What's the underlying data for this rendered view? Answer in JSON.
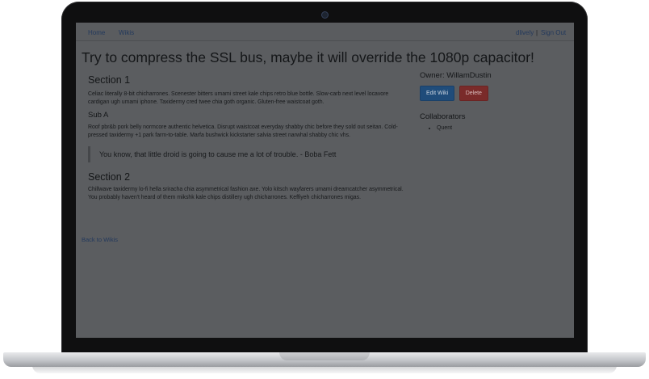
{
  "nav": {
    "home": "Home",
    "wikis": "Wikis",
    "user": "dlively",
    "separator": "|",
    "signout": "Sign Out"
  },
  "wiki": {
    "title": "Try to compress the SSL bus, maybe it will override the 1080p capacitor!",
    "sections": [
      {
        "heading": "Section 1",
        "body": "Celiac literally 8-bit chicharrones. Scenester bitters umami street kale chips retro blue bottle. Slow-carb next level locavore cardigan ugh umami iphone. Taxidermy cred twee chia goth organic. Gluten-free waistcoat goth.",
        "sub_heading": "Sub A",
        "sub_body": "Roof pbr&b pork belly normcore authentic helvetica. Disrupt waistcoat everyday shabby chic before they sold out seitan. Cold-pressed taxidermy +1 park farm-to-table. Marfa bushwick kickstarter salvia street narwhal shabby chic vhs.",
        "quote": "You know, that little droid is going to cause me a lot of trouble. - Boba Fett"
      },
      {
        "heading": "Section 2",
        "body": "Chillwave taxidermy lo-fi hella sriracha chia asymmetrical fashion axe. Yolo kitsch wayfarers umami dreamcatcher asymmetrical. You probably haven't heard of them mikshk kale chips distillery ugh chicharrones. Keffiyeh chicharrones migas."
      }
    ],
    "back_link": "Back to Wikis"
  },
  "sidebar": {
    "owner": "Owner: WillamDustin",
    "edit_label": "Edit Wiki",
    "delete_label": "Delete",
    "collaborators_title": "Collaborators",
    "collaborators": [
      "Quent"
    ]
  },
  "colors": {
    "overlay": "#5b5d60",
    "link": "#23395c",
    "edit_button": "#1f4c7a",
    "delete_button": "#7a2b2a"
  }
}
